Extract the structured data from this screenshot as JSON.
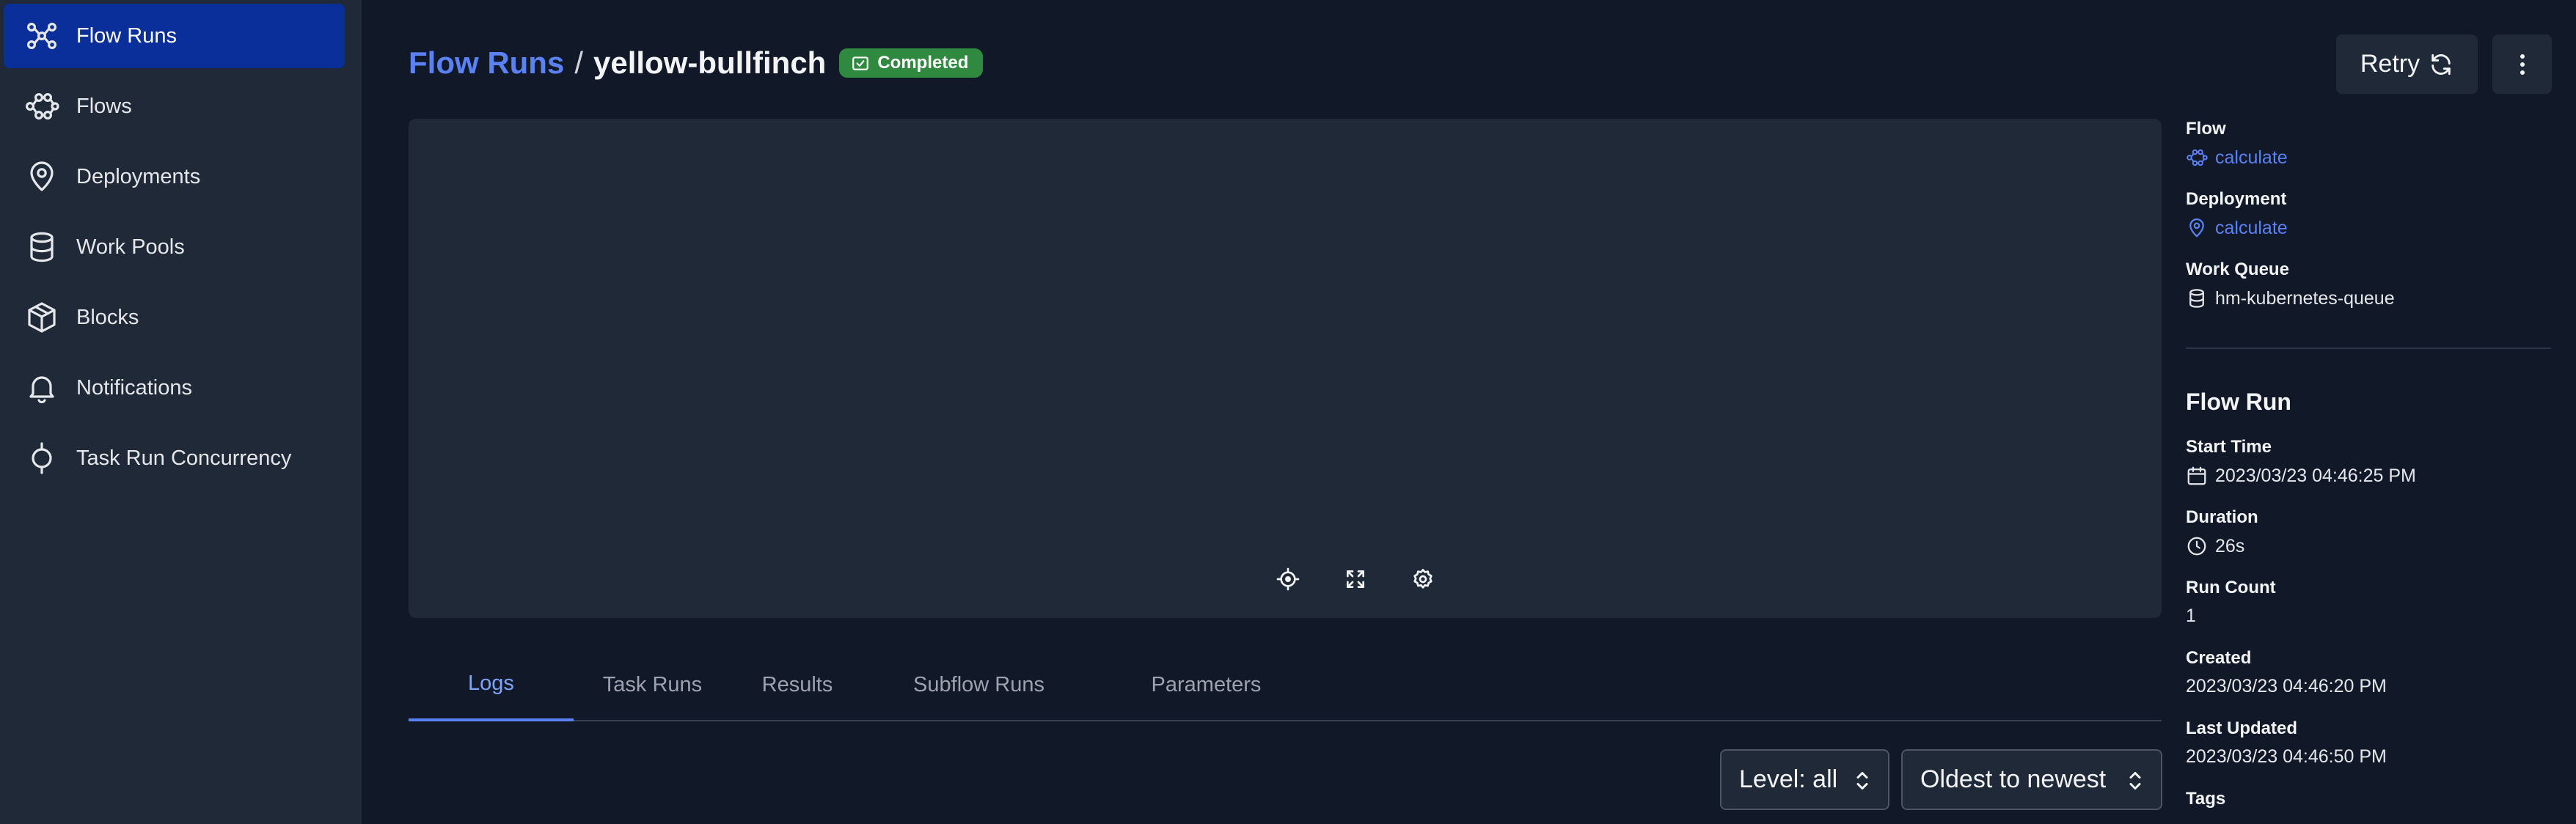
{
  "sidebar": {
    "items": [
      {
        "label": "Flow Runs",
        "icon": "flow-runs-icon",
        "active": true
      },
      {
        "label": "Flows",
        "icon": "flows-icon"
      },
      {
        "label": "Deployments",
        "icon": "map-pin-icon"
      },
      {
        "label": "Work Pools",
        "icon": "database-icon"
      },
      {
        "label": "Blocks",
        "icon": "cube-icon"
      },
      {
        "label": "Notifications",
        "icon": "bell-icon"
      },
      {
        "label": "Task Run Concurrency",
        "icon": "concurrency-icon"
      }
    ]
  },
  "header": {
    "breadcrumb_root": "Flow Runs",
    "separator": "/",
    "current": "yellow-bullfinch",
    "status": "Completed",
    "status_color": "#2f8a3f"
  },
  "actions": {
    "retry_label": "Retry"
  },
  "tabs": [
    "Logs",
    "Task Runs",
    "Results",
    "Subflow Runs",
    "Parameters"
  ],
  "active_tab": "Logs",
  "logs": {
    "level": "Level: all",
    "order": "Oldest to newest"
  },
  "details": {
    "flow_label": "Flow",
    "flow_value": "calculate",
    "deployment_label": "Deployment",
    "deployment_value": "calculate",
    "work_queue_label": "Work Queue",
    "work_queue_value": "hm-kubernetes-queue",
    "section_title": "Flow Run",
    "start_time_label": "Start Time",
    "start_time_value": "2023/03/23 04:46:25 PM",
    "duration_label": "Duration",
    "duration_value": "26s",
    "run_count_label": "Run Count",
    "run_count_value": "1",
    "created_label": "Created",
    "created_value": "2023/03/23 04:46:20 PM",
    "last_updated_label": "Last Updated",
    "last_updated_value": "2023/03/23 04:46:50 PM",
    "tags_label": "Tags"
  },
  "colors": {
    "accent": "#5b82f5",
    "sidebar_active": "#0b2f9a",
    "background": "#111827",
    "panel": "#1f2937"
  }
}
